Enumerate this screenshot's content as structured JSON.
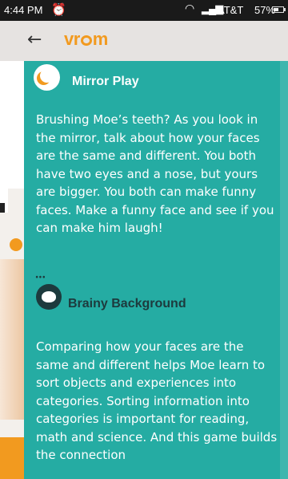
{
  "status_bar": {
    "time": "4:44 PM",
    "alarm_icon": "alarm-clock-icon",
    "wifi_icon": "wifi-icon",
    "signal_icon": "signal-bars-icon",
    "carrier": "AT&T",
    "battery": "57%",
    "battery_level": 0.57
  },
  "app_bar": {
    "back_icon": "back-arrow-icon",
    "logo_pre": "vr",
    "logo_post": "m",
    "brand_color": "#f29a1f"
  },
  "activity": {
    "title": "Mirror Play",
    "icon": "moon-icon",
    "body": "Brushing Moe’s teeth? As you look in the mirror, talk about how your faces are the same and different. You both have two eyes and a nose, but yours are bigger. You both can make funny faces. Make a funny face and see if you can make him laugh!",
    "background_color": "#25aca3"
  },
  "brainy_background": {
    "title": "Brainy Background",
    "icon": "brain-icon",
    "body": "Comparing how your faces are the same and different helps Moe learn to sort objects and experiences into categories. Sorting information into categories is important for reading, math and science. And this game builds the connection"
  }
}
